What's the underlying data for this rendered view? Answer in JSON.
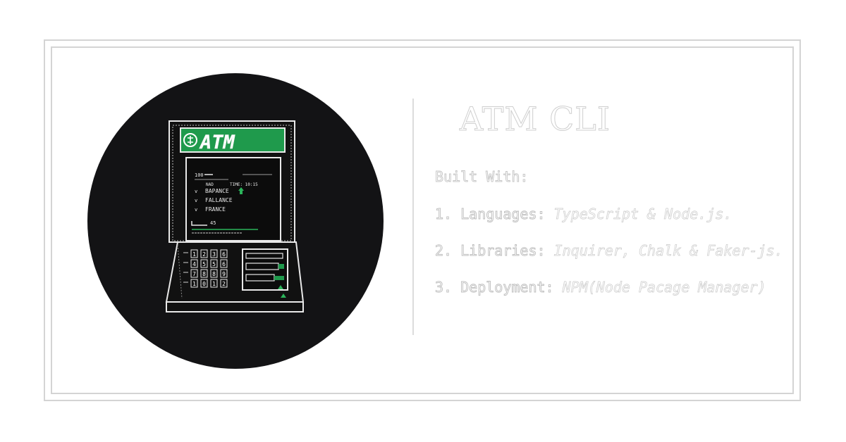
{
  "card": {
    "title": "ATM CLI",
    "built_with_label": "Built With:",
    "items": [
      {
        "number": "1.",
        "label": "Languages:",
        "value": "TypeScript & Node.js."
      },
      {
        "number": "2.",
        "label": "Libraries:",
        "value": "Inquirer, Chalk & Faker-js."
      },
      {
        "number": "3.",
        "label": "Deployment:",
        "value": "NPM(Node Pacage Manager)"
      }
    ]
  },
  "atm": {
    "brand": "ATM",
    "screen_number": "100",
    "screen_header_left": "NAD",
    "screen_header_right": "TIME: 10:15",
    "menu": [
      "BAPANCE",
      "FALLANCE",
      "FRANCE"
    ],
    "screen_footer": "45",
    "keypad": [
      "1",
      "2",
      "3",
      "6",
      "4",
      "5",
      "5",
      "6",
      "7",
      "8",
      "8",
      "9",
      "1",
      "0",
      "1",
      "2"
    ]
  },
  "colors": {
    "accent_green": "#1f9a4c",
    "badge_background": "#131315",
    "frame_border": "#d4d4d4"
  },
  "icons": {
    "atm_logo": "atm-logo-icon",
    "arrow": "up-arrow-icon"
  }
}
